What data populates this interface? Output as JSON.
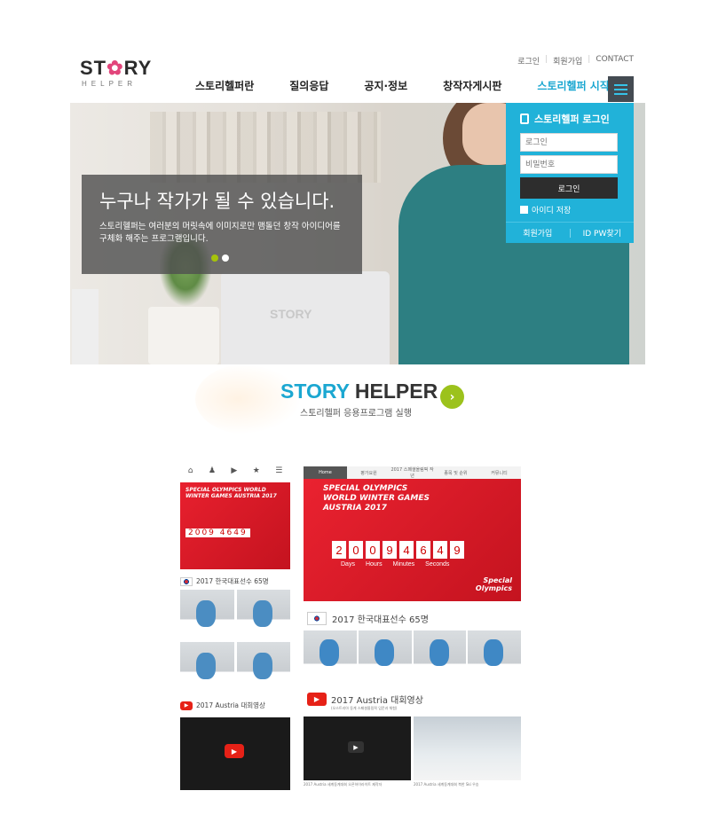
{
  "header": {
    "logo_main_left": "ST",
    "logo_star": "✿",
    "logo_main_right": "RY",
    "logo_sub": "HELPER",
    "top_links": [
      "로그인",
      "회원가입",
      "CONTACT"
    ],
    "nav": [
      "스토리헬퍼란",
      "질의응답",
      "공지·정보",
      "창작자게시판",
      "스토리헬퍼 시작"
    ]
  },
  "hero": {
    "headline": "누구나 작가가 될 수 있습니다.",
    "body_line1": "스토리헬퍼는 여러분의 머릿속에 이미지로만 맴돌던 창작 아이디어를",
    "body_line2": "구체화 해주는 프로그램입니다.",
    "laptop_logo": "STORY",
    "active_slide": 1,
    "slide_count": 2
  },
  "login": {
    "title": "스토리헬퍼 로그인",
    "id_placeholder": "로그인",
    "pw_placeholder": "비밀번호",
    "submit": "로그인",
    "save_id": "아이디 저장",
    "join": "회원가입",
    "find": "ID PW찾기"
  },
  "cta": {
    "title_blue": "STORY",
    "title_dark": " HELPER",
    "subtitle": "스토리헬퍼 응용프로그램 실행",
    "arrow": "›"
  },
  "mobile": {
    "icons": [
      "⌂",
      "♟",
      "▶",
      "★",
      "☰"
    ],
    "banner_title": "SPECIAL OLYMPICS WORLD WINTER GAMES AUSTRIA 2017",
    "counter": "2009 4649",
    "team_title": "2017 한국대표선수 65명",
    "video_title": "2017 Austria 대회영상",
    "play": "▶"
  },
  "desktop": {
    "nav": [
      "Home",
      "평가요원",
      "2017 스페셜올림픽 작년",
      "종목 및 순위",
      "커뮤니티"
    ],
    "banner_line1": "SPECIAL OLYMPICS",
    "banner_line2": "WORLD WINTER GAMES",
    "banner_line3": "AUSTRIA 2017",
    "digits": [
      "2",
      "0",
      "0",
      "9",
      "4",
      "6",
      "4",
      "9"
    ],
    "labels": [
      "Days",
      "Hours",
      "Minutes",
      "Seconds"
    ],
    "so_line1": "Special",
    "so_line2": "Olympics",
    "team_title": "2017 한국대표선수 65명",
    "video_title": "2017 Austria 대회영상",
    "video_sub": "(오스트리아 동계 스페셜올림픽 입문과 체험)",
    "captions": [
      "2017 Austria 세계동계대회 오픈하이라이트 제작자",
      "2017 Austria 세계동계대회 북한 Ski 우승"
    ],
    "play": "▶"
  },
  "colors": {
    "accent": "#1ba7d1",
    "login_bg": "#21b2d9",
    "cta_button": "#9cc21c",
    "special_red": "#e8202e"
  }
}
